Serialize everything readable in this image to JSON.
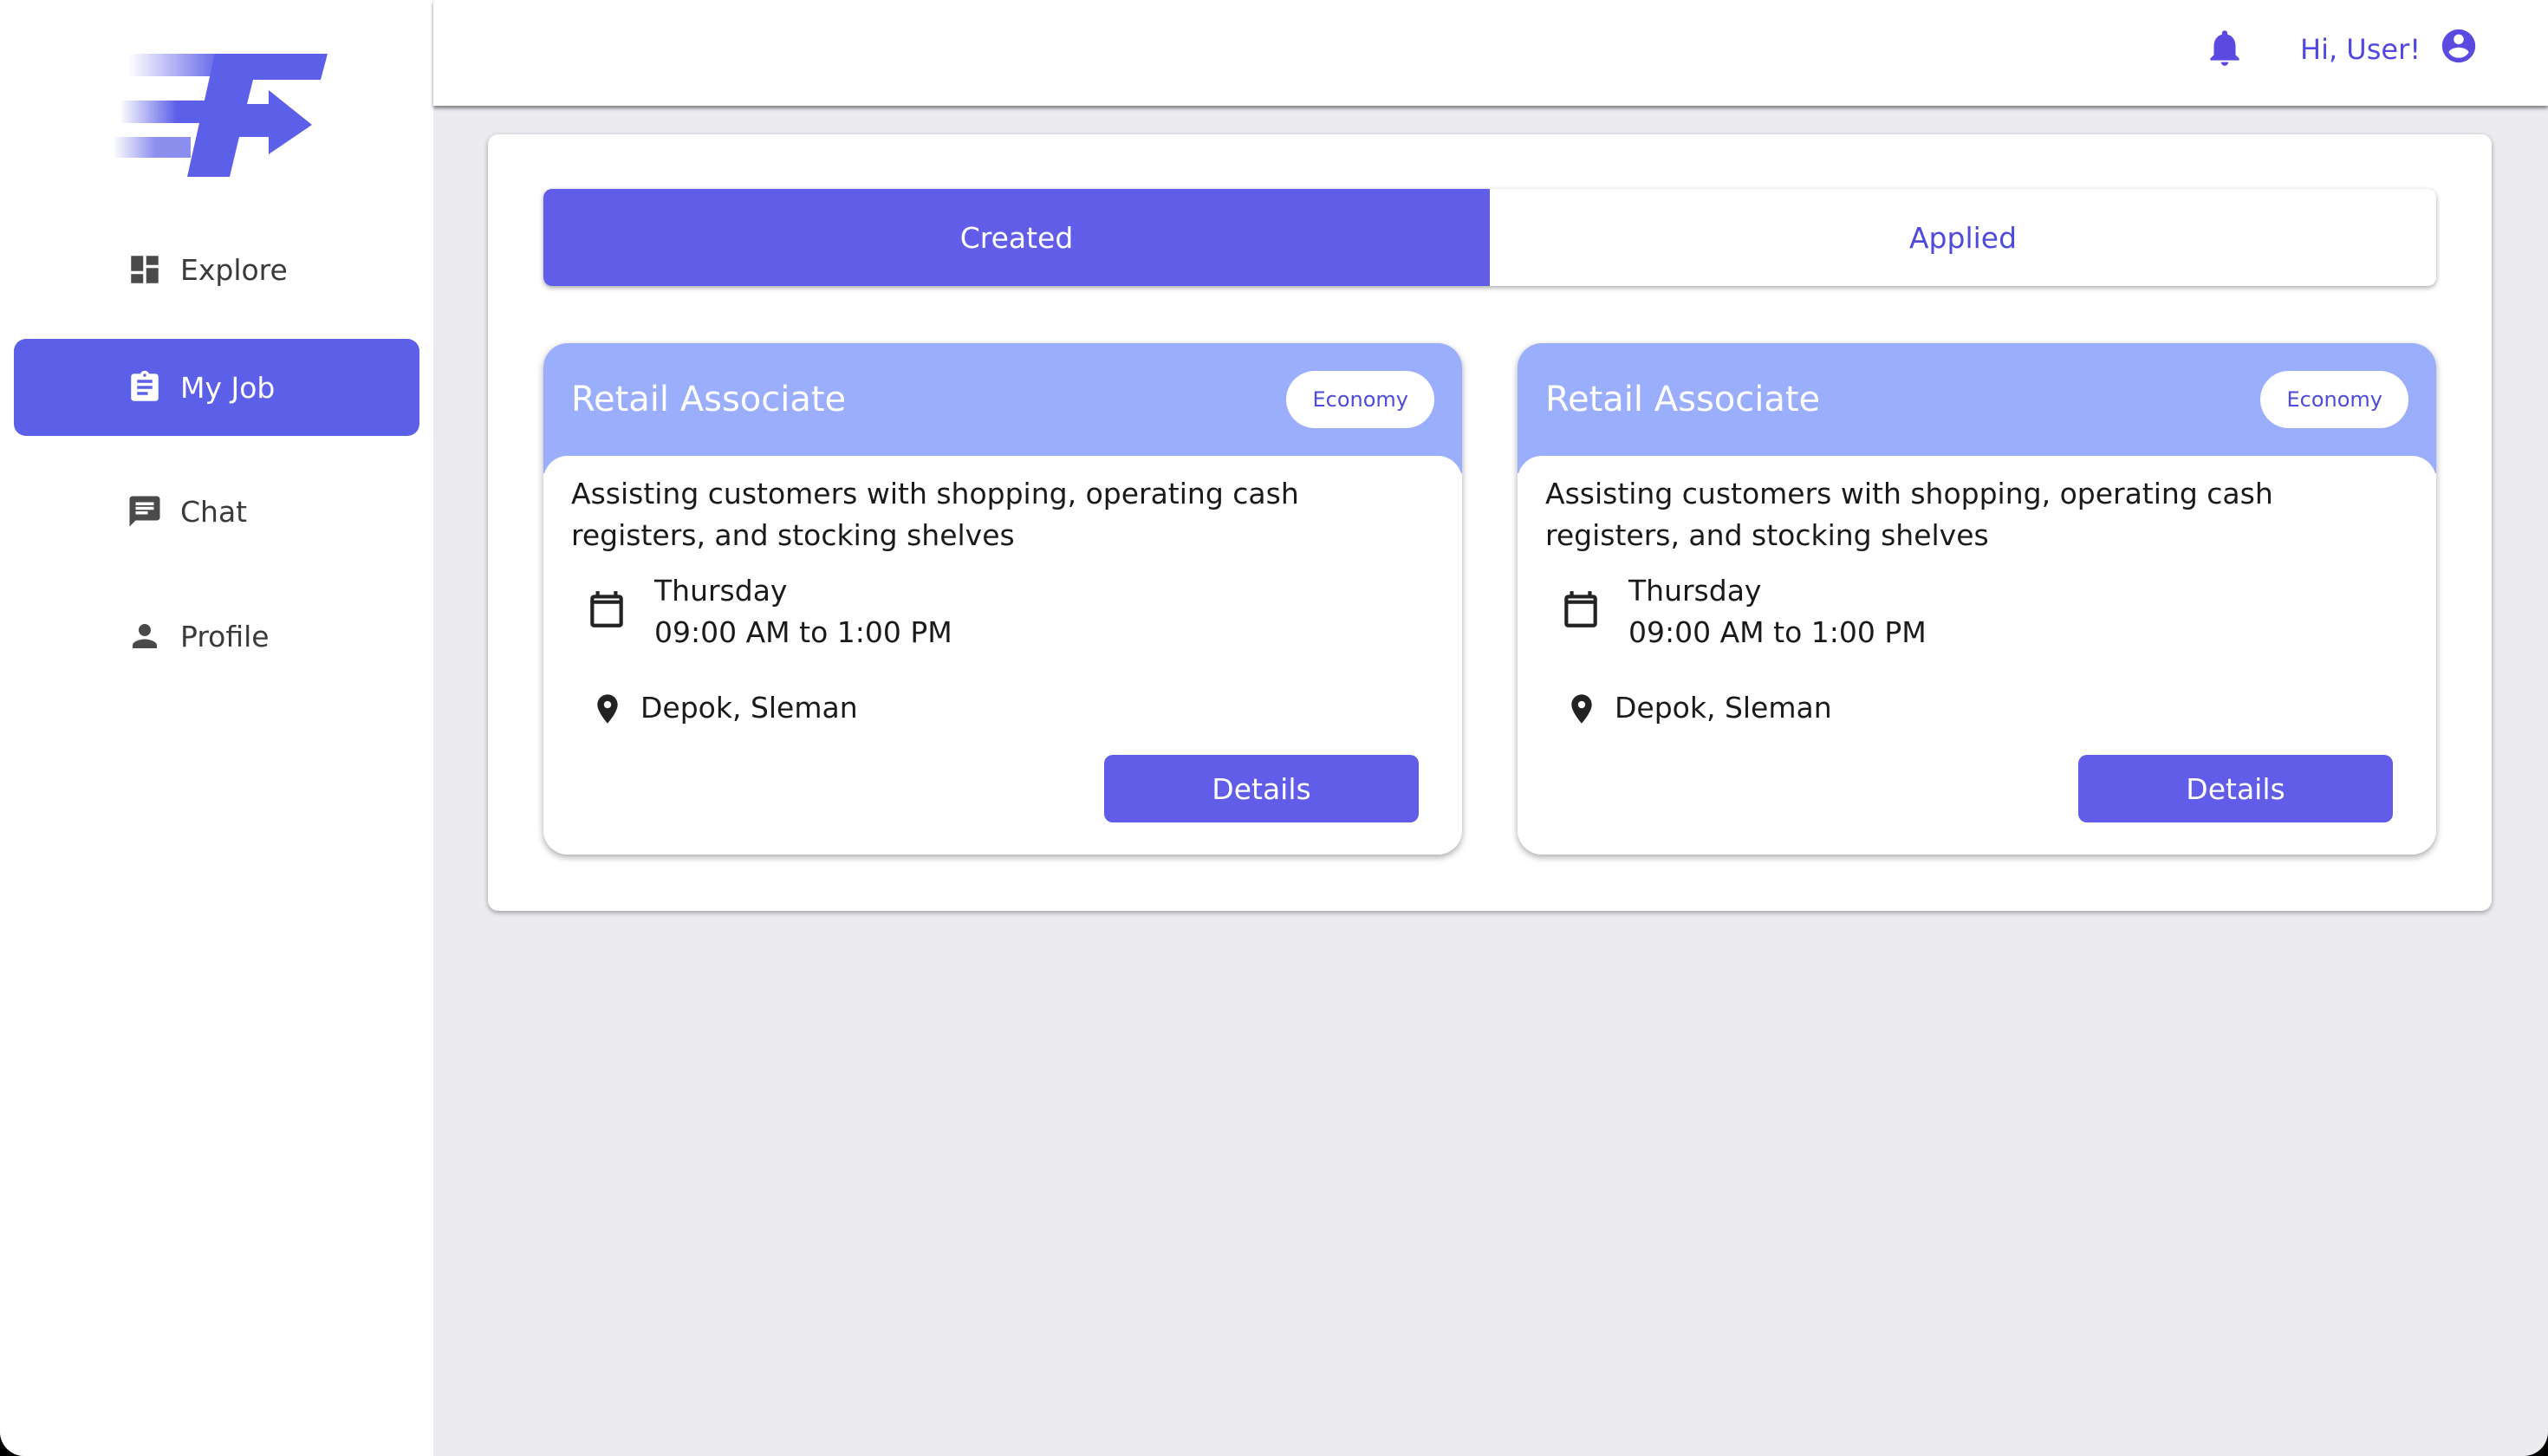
{
  "app": {
    "logo_icon": "app-logo-f-arrow",
    "accent_color": "#5c5fe8"
  },
  "sidebar": {
    "items": [
      {
        "label": "Explore",
        "icon": "dashboard-icon",
        "active": false
      },
      {
        "label": "My Job",
        "icon": "clipboard-icon",
        "active": true
      },
      {
        "label": "Chat",
        "icon": "chat-icon",
        "active": false
      },
      {
        "label": "Profile",
        "icon": "person-icon",
        "active": false
      }
    ]
  },
  "header": {
    "notification_icon": "bell-icon",
    "greeting": "Hi, User!",
    "account_icon": "account-circle-icon"
  },
  "tabs": [
    {
      "label": "Created",
      "active": true
    },
    {
      "label": "Applied",
      "active": false
    }
  ],
  "jobs": [
    {
      "title": "Retail Associate",
      "category": "Economy",
      "description": "Assisting customers with shopping, operating cash registers, and stocking shelves",
      "day": "Thursday",
      "time": "09:00 AM to 1:00 PM",
      "location": "Depok, Sleman",
      "button_label": "Details"
    },
    {
      "title": "Retail Associate",
      "category": "Economy",
      "description": "Assisting customers with shopping, operating cash registers, and stocking shelves",
      "day": "Thursday",
      "time": "09:00 AM to 1:00 PM",
      "location": "Depok, Sleman",
      "button_label": "Details"
    }
  ]
}
